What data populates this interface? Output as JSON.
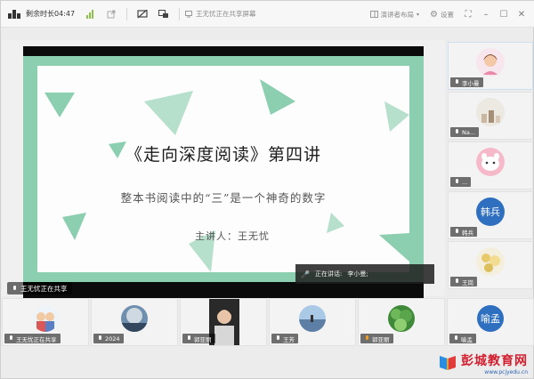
{
  "topbar": {
    "remaining_time": "剩余时长04:47",
    "share_status": "王无忧正在共享屏幕",
    "layout_button": "演讲者布局",
    "settings_button": "设置"
  },
  "slide": {
    "title": "《走向深度阅读》第四讲",
    "subtitle": "整本书阅读中的“三”是一个神奇的数字",
    "speaker": "主讲人：王无忧",
    "accent_color": "#8ccfb0"
  },
  "stage": {
    "share_label": "王无忧正在共享",
    "speaking_prefix": "正在讲话:",
    "speaking_name": "李小曼;"
  },
  "side_tiles": [
    {
      "name": "李小曼"
    },
    {
      "name": "Na..."
    },
    {
      "name": "..."
    },
    {
      "name": "韩兵",
      "avatar_text": "韩兵"
    },
    {
      "name": "王岗"
    }
  ],
  "bottom_tiles": [
    {
      "name": "王无忧正在共享"
    },
    {
      "name": "2024"
    },
    {
      "name": "郭亚丽"
    },
    {
      "name": "王芳"
    },
    {
      "name": "郭亚丽"
    },
    {
      "name": "喻孟",
      "avatar_text": "喻孟"
    }
  ],
  "watermark": {
    "text": "彭城教育网",
    "url": "www.pcjyedu.cn"
  }
}
